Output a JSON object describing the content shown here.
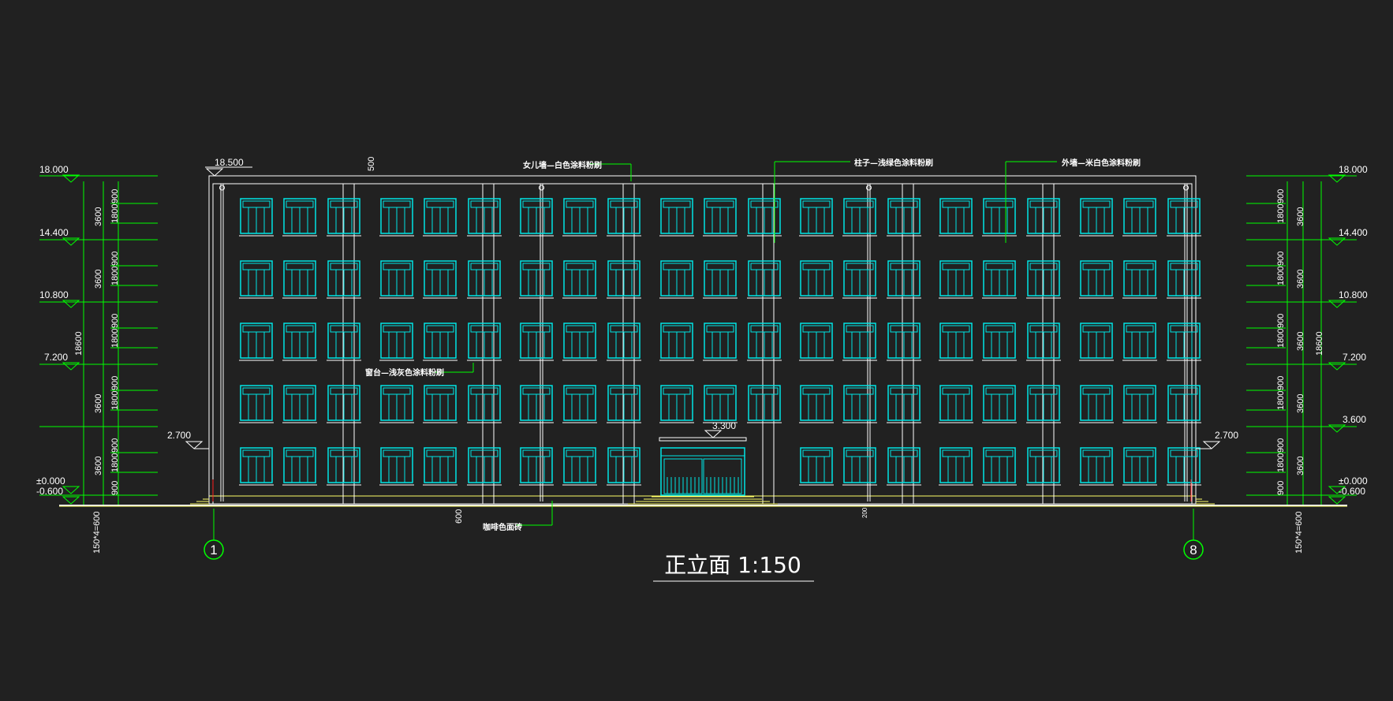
{
  "drawing": {
    "title": "正立面 1:150",
    "colors": {
      "background": "#212121",
      "window": "#00e5e5",
      "dimension": "#00ff00",
      "outline": "#ffffff",
      "ground": "#ffff66",
      "accent": "#ff2020"
    },
    "window_rows": 5,
    "window_columns_per_bay": 3,
    "bays": 7,
    "entrance_bay": 4
  },
  "levels_left": [
    "18.000",
    "14.400",
    "10.800",
    "7.200",
    "±0.000",
    "-0.600"
  ],
  "levels_right": [
    "18.000",
    "14.400",
    "10.800",
    "7.200",
    "3.600",
    "±0.000",
    "-0.600"
  ],
  "level_markers": {
    "roof_left": "18.500",
    "canopy": "3.300",
    "side_left": "2.700",
    "side_right": "2.700"
  },
  "dimensions": {
    "floor": "3600",
    "sill": "900",
    "window": "1800",
    "total": "18600",
    "steps": "150*4=600",
    "parapet": "500",
    "base": "600",
    "column": "200"
  },
  "notes": {
    "parapet": "女儿墙—白色涂料粉刷",
    "columns": "柱子—浅绿色涂料粉刷",
    "walls": "外墙—米白色涂料粉刷",
    "sills": "窗台—浅灰色涂料粉刷",
    "plinth": "咖啡色面砖"
  },
  "axes": [
    "1",
    "8"
  ]
}
